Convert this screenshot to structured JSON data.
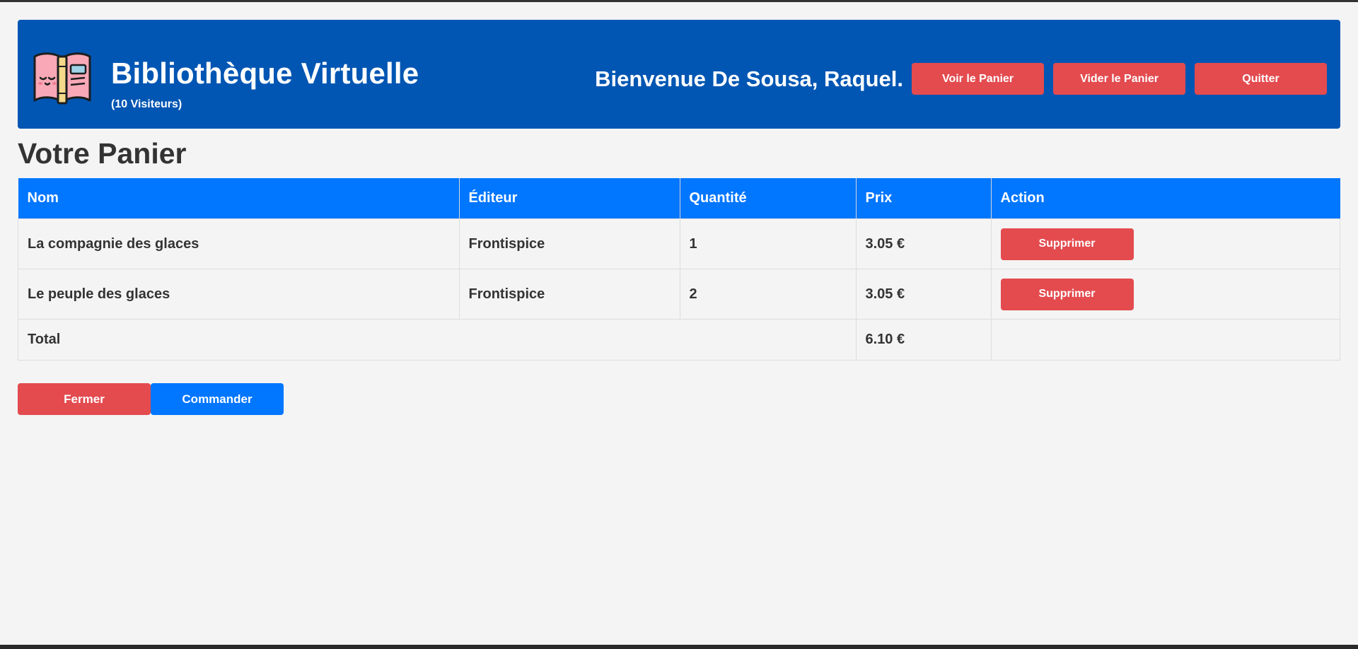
{
  "header": {
    "title": "Bibliothèque Virtuelle",
    "visitors": "(10 Visiteurs)",
    "welcome": "Bienvenue De Sousa, Raquel.",
    "buttons": {
      "view_cart": "Voir le Panier",
      "empty_cart": "Vider le Panier",
      "quit": "Quitter"
    },
    "logo_icon": "open-book-icon"
  },
  "cart": {
    "title": "Votre Panier",
    "columns": [
      "Nom",
      "Éditeur",
      "Quantité",
      "Prix",
      "Action"
    ],
    "rows": [
      {
        "name": "La compagnie des glaces",
        "publisher": "Frontispice",
        "quantity": "1",
        "price": "3.05 €",
        "action": "Supprimer"
      },
      {
        "name": "Le peuple des glaces",
        "publisher": "Frontispice",
        "quantity": "2",
        "price": "3.05 €",
        "action": "Supprimer"
      }
    ],
    "total_label": "Total",
    "total_value": "6.10 €"
  },
  "actions": {
    "close": "Fermer",
    "order": "Commander"
  },
  "colors": {
    "header_bg": "#0156b3",
    "table_header_bg": "#0176ff",
    "danger": "#e34b4f",
    "primary": "#0176ff",
    "page_bg": "#f4f4f4"
  }
}
